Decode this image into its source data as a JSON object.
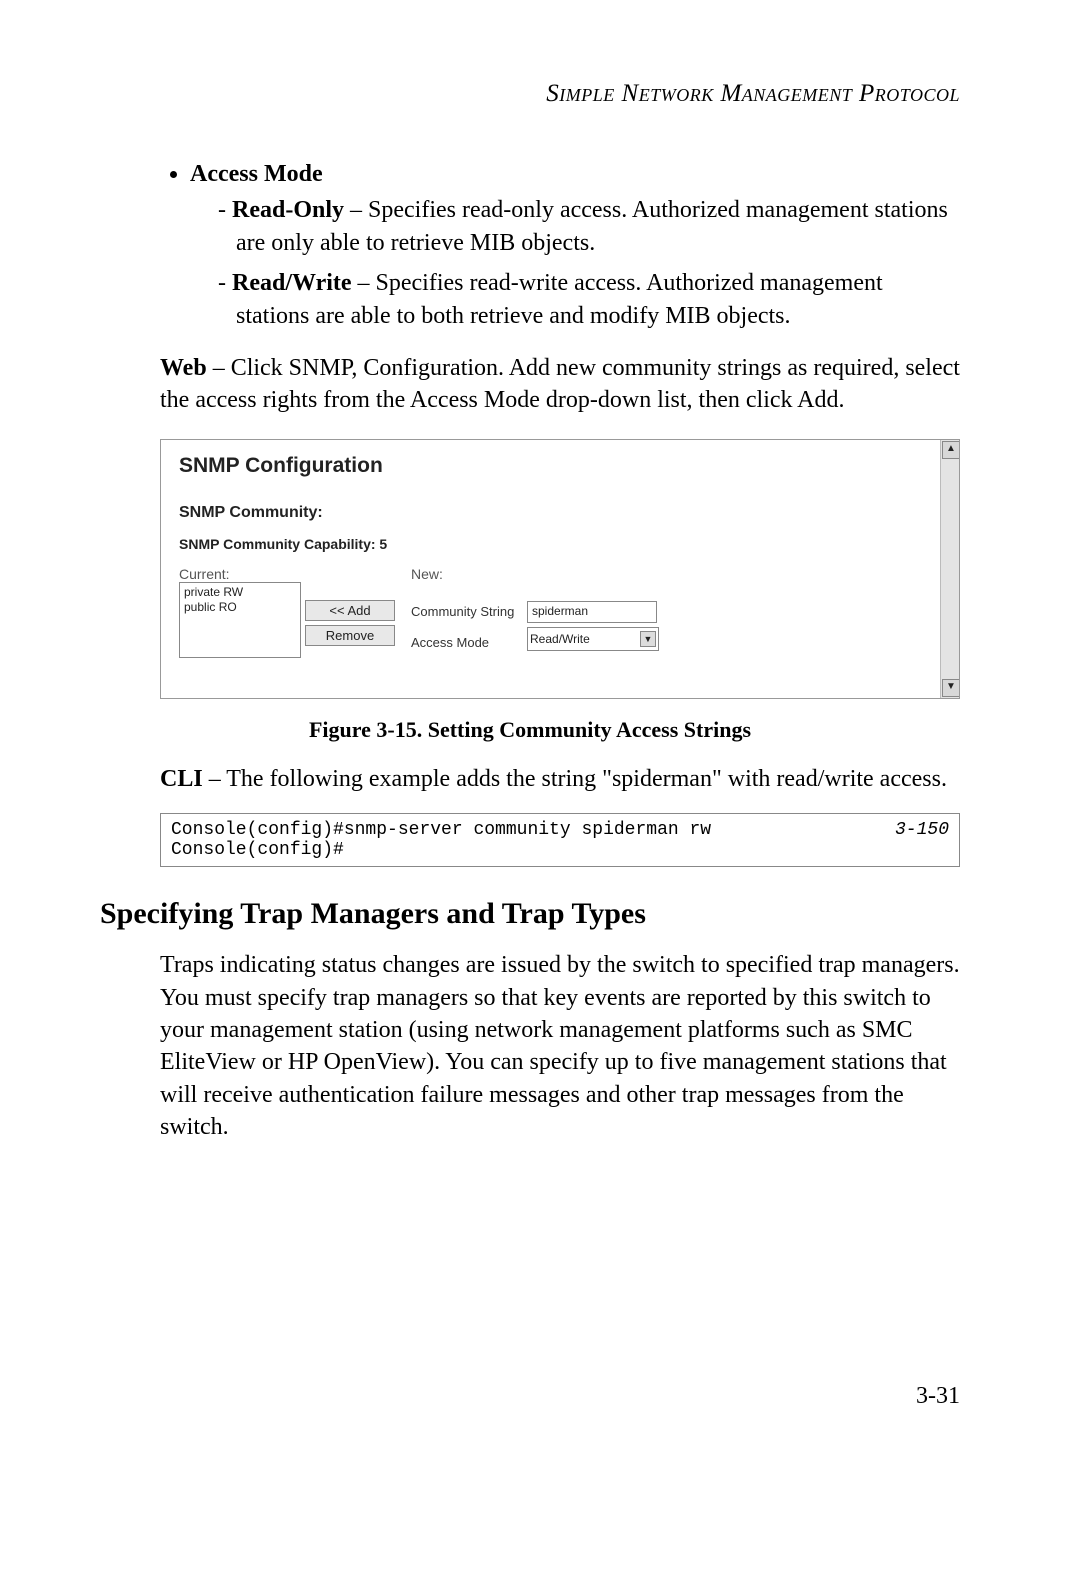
{
  "header": {
    "running_title": "Simple Network Management Protocol"
  },
  "bullets": {
    "access_mode_label": "Access Mode",
    "read_only_label": "Read-Only",
    "read_only_text": " – Specifies read-only access. Authorized management stations are only able to retrieve MIB objects.",
    "read_write_label": "Read/Write",
    "read_write_text": " – Specifies read-write access. Authorized management stations are able to both retrieve and modify MIB objects."
  },
  "web_para": {
    "lead": "Web",
    "text": " – Click SNMP, Configuration. Add new community strings as required, select the access rights from the Access Mode drop-down list, then click Add."
  },
  "panel": {
    "title": "SNMP Configuration",
    "subtitle": "SNMP Community:",
    "capability": "SNMP Community Capability: 5",
    "current_label": "Current:",
    "new_label": "New:",
    "current_items": [
      "private RW",
      "public RO"
    ],
    "add_button": "<< Add",
    "remove_button": "Remove",
    "community_string_label": "Community String",
    "community_string_value": "spiderman",
    "access_mode_label": "Access Mode",
    "access_mode_value": "Read/Write"
  },
  "figure_caption": "Figure 3-15.  Setting Community Access Strings",
  "cli_para": {
    "lead": "CLI",
    "text": " – The following example adds the string \"spiderman\" with read/write access."
  },
  "code": {
    "lines": "Console(config)#snmp-server community spiderman rw\nConsole(config)#",
    "ref": "3-150"
  },
  "section_heading": "Specifying Trap Managers and Trap Types",
  "section_para": "Traps indicating status changes are issued by the switch to specified trap managers. You must specify trap managers so that key events are reported by this switch to your management station (using network management platforms such as SMC EliteView or HP OpenView). You can specify up to five management stations that will receive authentication failure messages and other trap messages from the switch.",
  "page_number": "3-31"
}
